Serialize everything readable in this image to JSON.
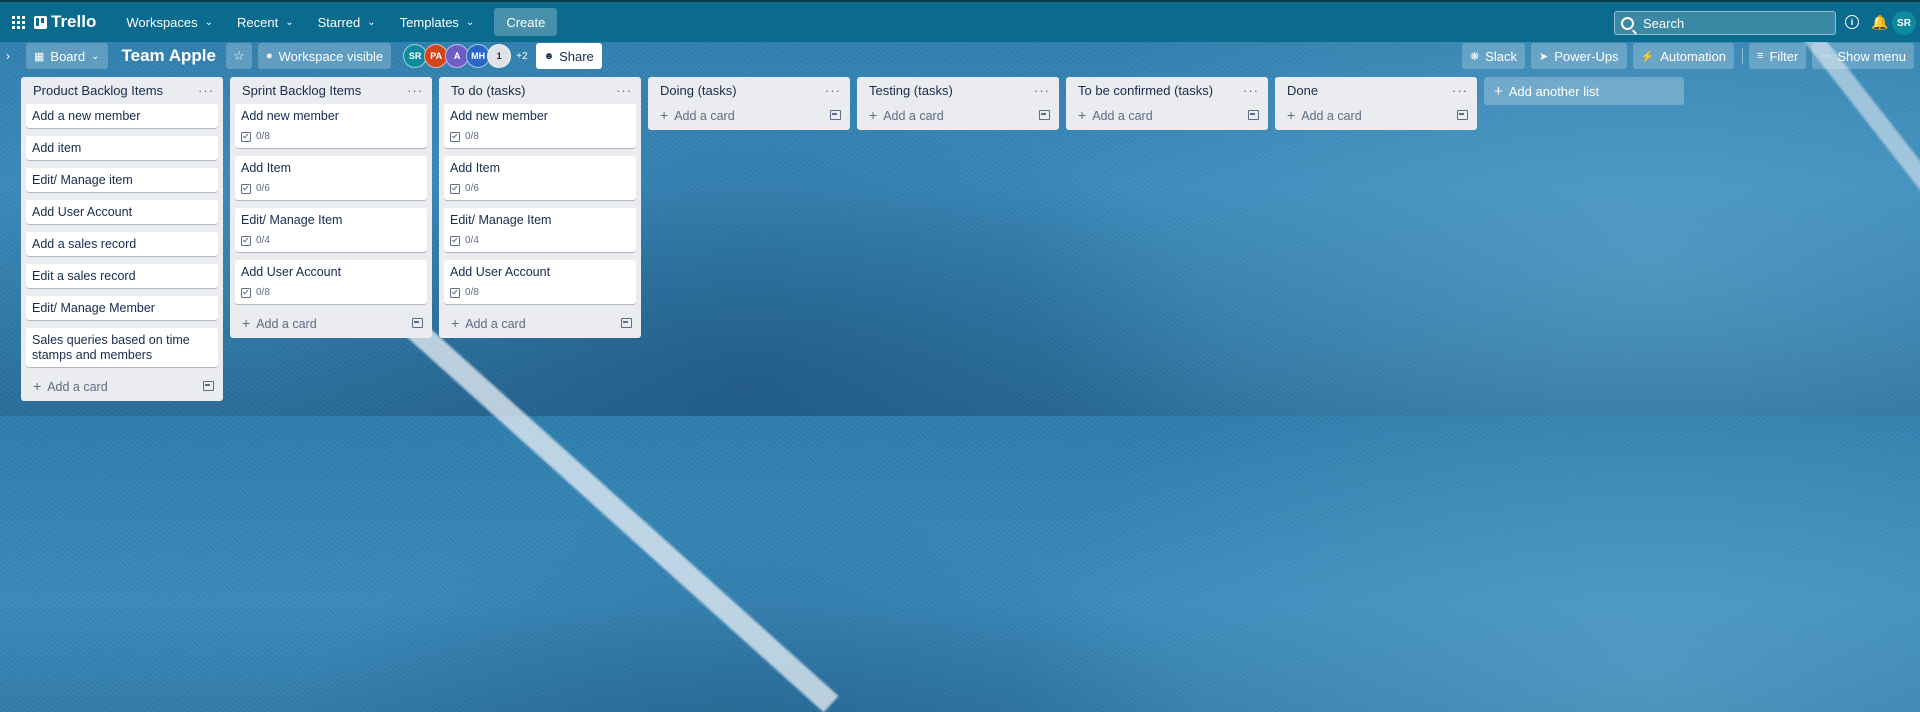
{
  "topnav": {
    "app_name": "Trello",
    "menus": [
      {
        "label": "Workspaces"
      },
      {
        "label": "Recent"
      },
      {
        "label": "Starred"
      },
      {
        "label": "Templates"
      }
    ],
    "create_label": "Create",
    "search_placeholder": "Search",
    "user_initials": "SR"
  },
  "board": {
    "view_label": "Board",
    "title": "Team Apple",
    "visibility_label": "Workspace visible",
    "members": [
      {
        "initials": "SR",
        "color": "#0e8a9e"
      },
      {
        "initials": "PA",
        "color": "#d0451b"
      },
      {
        "initials": "A",
        "color": "#6e5dc6"
      },
      {
        "initials": "MH",
        "color": "#2a66c4"
      },
      {
        "initials": "1",
        "color": "#dfe1e6"
      }
    ],
    "extra_members": "+2",
    "share_label": "Share",
    "actions": {
      "slack": "Slack",
      "powerups": "Power-Ups",
      "automation": "Automation",
      "filter": "Filter",
      "show_menu": "Show menu"
    }
  },
  "lists": [
    {
      "title": "Product Backlog Items",
      "cards": [
        {
          "title": "Add a new member",
          "badge": ""
        },
        {
          "title": "Add item",
          "badge": ""
        },
        {
          "title": "Edit/ Manage item",
          "badge": ""
        },
        {
          "title": "Add User Account",
          "badge": ""
        },
        {
          "title": "Add a sales record",
          "badge": ""
        },
        {
          "title": "Edit a sales record",
          "badge": ""
        },
        {
          "title": "Edit/ Manage Member",
          "badge": ""
        },
        {
          "title": "Sales queries based on time stamps and members",
          "badge": ""
        }
      ]
    },
    {
      "title": "Sprint Backlog Items",
      "cards": [
        {
          "title": "Add new member",
          "badge": "0/8"
        },
        {
          "title": "Add Item",
          "badge": "0/6"
        },
        {
          "title": "Edit/ Manage Item",
          "badge": "0/4"
        },
        {
          "title": "Add User Account",
          "badge": "0/8"
        }
      ]
    },
    {
      "title": "To do (tasks)",
      "cards": [
        {
          "title": "Add new member",
          "badge": "0/8"
        },
        {
          "title": "Add Item",
          "badge": "0/6"
        },
        {
          "title": "Edit/ Manage Item",
          "badge": "0/4"
        },
        {
          "title": "Add User Account",
          "badge": "0/8"
        }
      ]
    },
    {
      "title": "Doing (tasks)",
      "cards": []
    },
    {
      "title": "Testing (tasks)",
      "cards": []
    },
    {
      "title": "To be confirmed (tasks)",
      "cards": []
    },
    {
      "title": "Done",
      "cards": []
    }
  ],
  "add_card_label": "Add a card",
  "add_list_label": "Add another list"
}
